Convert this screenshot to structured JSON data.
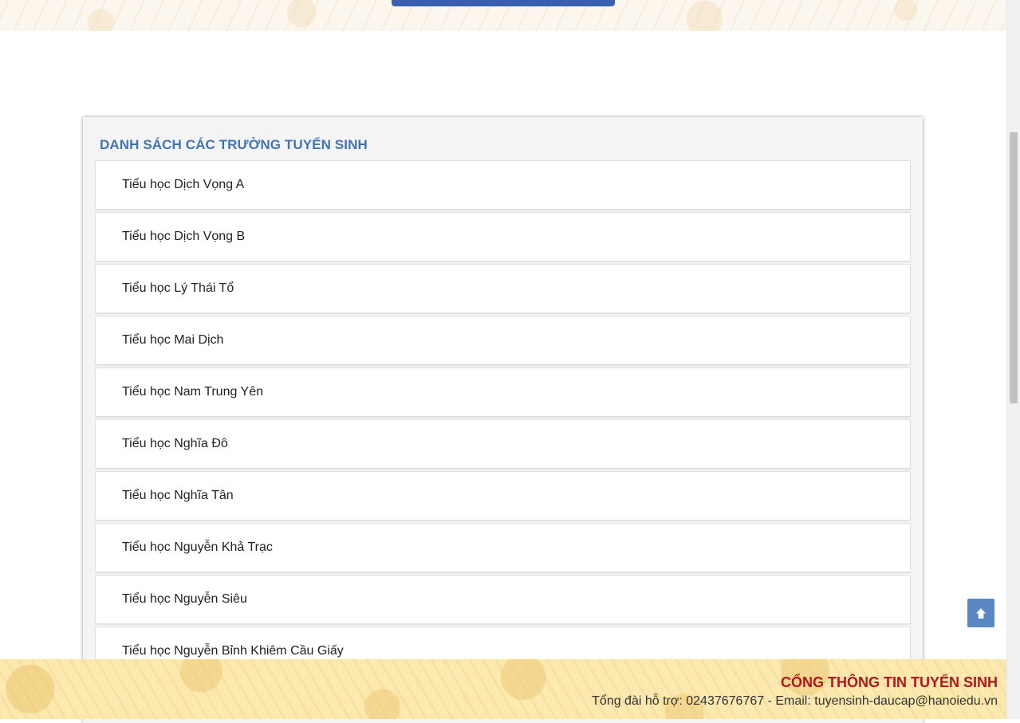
{
  "panel": {
    "title": "DANH SÁCH CÁC TRƯỜNG TUYỂN SINH"
  },
  "schools": [
    "Tiểu học Dịch Vọng A",
    "Tiểu học Dịch Vọng B",
    "Tiểu học Lý Thái Tổ",
    "Tiểu học Mai Dịch",
    "Tiểu học Nam Trung Yên",
    "Tiểu học Nghĩa Đô",
    "Tiểu học Nghĩa Tân",
    "Tiểu học Nguyễn Khả Trạc",
    "Tiểu học Nguyễn Siêu",
    "Tiểu học Nguyễn Bỉnh Khiêm Cầu Giấy"
  ],
  "footer": {
    "title": "CỔNG THÔNG TIN TUYỂN SINH",
    "contact": "Tổng đài hỗ trợ: 02437676767 - Email: tuyensinh-daucap@hanoiedu.vn"
  },
  "icons": {
    "back_to_top": "arrow-up-icon"
  },
  "colors": {
    "accent": "#4173b6",
    "footer_title": "#b4151b",
    "button": "#3a5fb0"
  }
}
